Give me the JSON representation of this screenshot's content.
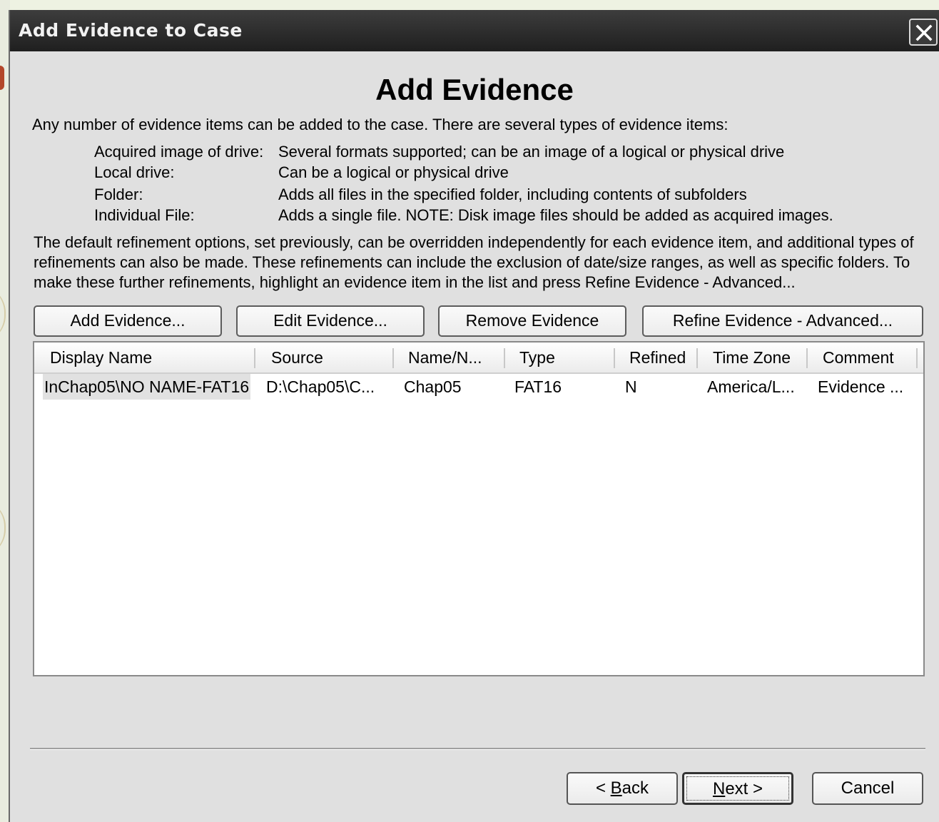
{
  "window": {
    "title": "Add Evidence to Case",
    "close_icon": "close-icon"
  },
  "heading": "Add Evidence",
  "intro": "Any number of evidence items can be added to the case. There are several types of evidence items:",
  "evidence_types": [
    {
      "label": "Acquired image of drive:",
      "description": "Several formats supported; can be an image of a logical or physical drive"
    },
    {
      "label": "Local drive:",
      "description": "Can be a logical or physical drive"
    },
    {
      "label": "Folder:",
      "description": "Adds all files in the specified folder, including contents of subfolders"
    },
    {
      "label": "Individual File:",
      "description": "Adds a single file.  NOTE: Disk image files should be added as acquired images."
    }
  ],
  "paragraph": "The default refinement options, set previously, can be overridden independently for each evidence item, and additional types of refinements can also be made. These refinements can include the exclusion of date/size ranges, as well as specific folders. To make these further refinements, highlight an evidence item in the list and press Refine Evidence - Advanced...",
  "toolbar": {
    "add_label": "Add Evidence...",
    "edit_label": "Edit Evidence...",
    "remove_label": "Remove Evidence",
    "refine_label": "Refine Evidence - Advanced..."
  },
  "table": {
    "columns": [
      "Display Name",
      "Source",
      "Name/N...",
      "Type",
      "Refined",
      "Time Zone",
      "Comment"
    ],
    "rows": [
      [
        "InChap05\\NO NAME-FAT16",
        "D:\\Chap05\\C...",
        "Chap05",
        "FAT16",
        "N",
        "America/L...",
        "Evidence ..."
      ]
    ]
  },
  "nav": {
    "back_prefix": "< ",
    "back_mnemonic": "B",
    "back_rest": "ack",
    "next_mnemonic": "N",
    "next_rest": "ext >",
    "cancel_label": "Cancel"
  }
}
